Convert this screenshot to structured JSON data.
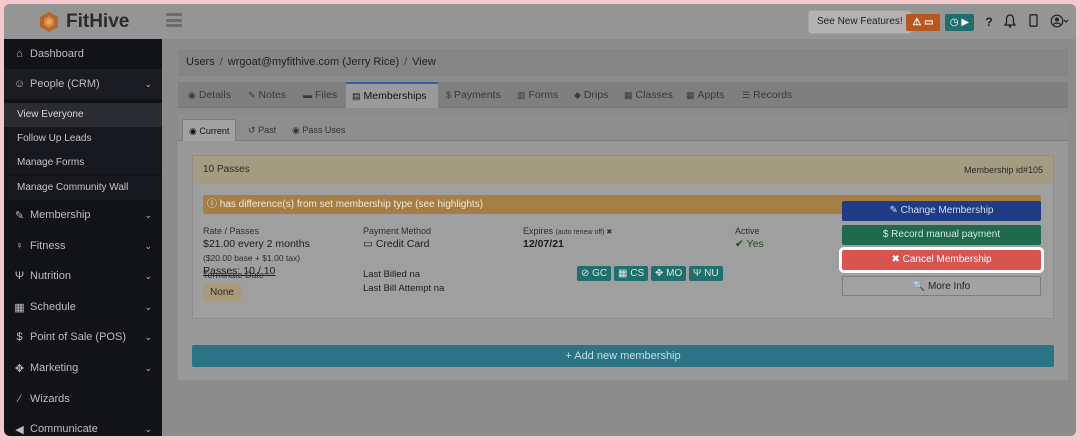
{
  "app": {
    "name": "FitHive"
  },
  "topbar": {
    "features_label": "See New Features!",
    "alert_label": "⚠ ▭",
    "timer_label": "◷ ▶",
    "help_icon": "question-icon",
    "bell_icon": "bell-icon",
    "mobile_icon": "mobile-icon",
    "user_icon": "user-menu-icon"
  },
  "sidebar": {
    "items": [
      {
        "label": "Dashboard",
        "icon": "home-icon",
        "glyph": "⌂"
      },
      {
        "label": "People (CRM)",
        "icon": "people-icon",
        "glyph": "☺",
        "chev": "⌄"
      },
      {
        "label": "Membership",
        "icon": "edit-icon",
        "glyph": "✎",
        "chev": "⌄"
      },
      {
        "label": "Fitness",
        "icon": "fitness-icon",
        "glyph": "♀",
        "chev": "⌄"
      },
      {
        "label": "Nutrition",
        "icon": "utensils-icon",
        "glyph": "Ψ",
        "chev": "⌄"
      },
      {
        "label": "Schedule",
        "icon": "calendar-icon",
        "glyph": "▦",
        "chev": "⌄"
      },
      {
        "label": "Point of Sale (POS)",
        "icon": "dollar-icon",
        "glyph": "$",
        "chev": "⌄"
      },
      {
        "label": "Marketing",
        "icon": "bullhorn-icon",
        "glyph": "✥",
        "chev": "⌄"
      },
      {
        "label": "Wizards",
        "icon": "wand-icon",
        "glyph": "⁄",
        "chev": ""
      },
      {
        "label": "Communicate",
        "icon": "megaphone-icon",
        "glyph": "◀",
        "chev": "⌄"
      }
    ],
    "sub_items": [
      "View Everyone",
      "Follow Up Leads",
      "Manage Forms",
      "Manage Community Wall"
    ]
  },
  "breadcrumb": {
    "root": "Users",
    "user": "wrgoat@myfithive.com (Jerry Rice)",
    "current": "View"
  },
  "tabs": [
    {
      "label": "Details",
      "glyph": "◉"
    },
    {
      "label": "Notes",
      "glyph": "✎"
    },
    {
      "label": "Files",
      "glyph": "▬"
    },
    {
      "label": "Memberships",
      "glyph": "▤"
    },
    {
      "label": "Payments",
      "glyph": "$"
    },
    {
      "label": "Forms",
      "glyph": "▥"
    },
    {
      "label": "Drips",
      "glyph": "◆"
    },
    {
      "label": "Classes",
      "glyph": "▦"
    },
    {
      "label": "Appts",
      "glyph": "▦"
    },
    {
      "label": "Records",
      "glyph": "☰"
    }
  ],
  "subtabs": [
    {
      "label": "Current",
      "glyph": "◉"
    },
    {
      "label": "Past",
      "glyph": "↺"
    },
    {
      "label": "Pass Uses",
      "glyph": "◉"
    }
  ],
  "membership": {
    "title": "10 Passes",
    "id_label": "Membership id#105",
    "warning": "ⓘ has difference(s) from set membership type (see highlights)",
    "rate_label": "Rate / Passes",
    "rate_value": "$21.00 every 2 months",
    "rate_breakdown": "($20.00 base + $1.00 tax)",
    "passes": "Passes: 10 / 10",
    "payment_label": "Payment Method",
    "payment_value": "▭ Credit Card",
    "expires_label": "Expires",
    "expires_note": "(auto renew off) ✖",
    "expires_value": "12/07/21",
    "active_label": "Active",
    "active_value": "✔ Yes",
    "terminate_label": "Terminate Date",
    "terminate_value": "None",
    "last_billed_label": "Last Billed",
    "last_billed_value": "na",
    "last_attempt_label": "Last Bill Attempt",
    "last_attempt_value": "na",
    "tags": [
      "⊘ GC",
      "▦ CS",
      "✥ MO",
      "Ψ NU"
    ]
  },
  "actions": {
    "change": "✎ Change Membership",
    "record": "$ Record manual payment",
    "cancel": "✖ Cancel Membership",
    "more": "🔍 More Info"
  },
  "add_membership": "+ Add new membership",
  "colors": {
    "cancel": "#d9534f",
    "change": "#1e3b86",
    "record": "#1d6a4c",
    "sidebar": "#121317",
    "accent": "#2b63a8"
  }
}
